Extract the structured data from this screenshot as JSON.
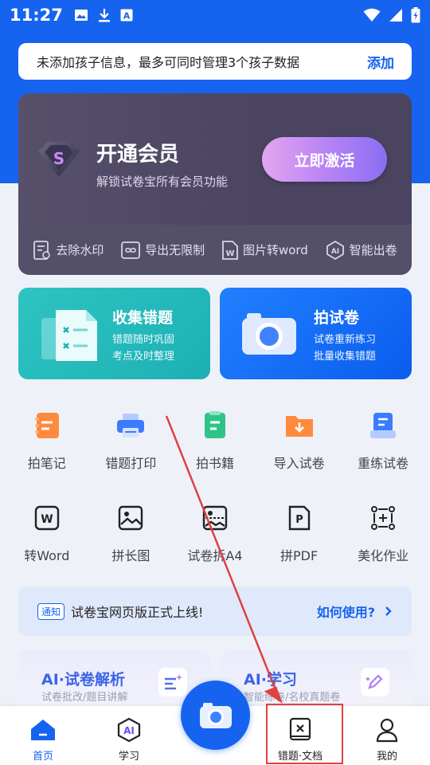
{
  "status_bar": {
    "time": "11:27"
  },
  "top_notice": {
    "text": "未添加孩子信息，最多可同时管理3个孩子数据",
    "action": "添加"
  },
  "vip": {
    "title": "开通会员",
    "subtitle": "解锁试卷宝所有会员功能",
    "button": "立即激活",
    "features": [
      "去除水印",
      "导出无限制",
      "图片转word",
      "智能出卷"
    ]
  },
  "cards": [
    {
      "title": "收集错题",
      "line1": "错题随时巩固",
      "line2": "考点及时整理"
    },
    {
      "title": "拍试卷",
      "line1": "试卷重新练习",
      "line2": "批量收集错题"
    }
  ],
  "tools_row1": [
    "拍笔记",
    "错题打印",
    "拍书籍",
    "导入试卷",
    "重练试卷"
  ],
  "tools_row2": [
    "转Word",
    "拼长图",
    "试卷拆A4",
    "拼PDF",
    "美化作业"
  ],
  "notice": {
    "tag": "通知",
    "text": "试卷宝网页版正式上线!",
    "link": "如何使用?"
  },
  "ai_cards": [
    {
      "title": "AI·试卷解析",
      "sub": "试卷批改/题目讲解"
    },
    {
      "title": "AI·学习",
      "sub": "智能练卷/名校真题卷"
    }
  ],
  "tabs": [
    "首页",
    "学习",
    "错题·文档",
    "我的"
  ],
  "colors": {
    "primary": "#1663f0",
    "annotation": "#e04040"
  }
}
